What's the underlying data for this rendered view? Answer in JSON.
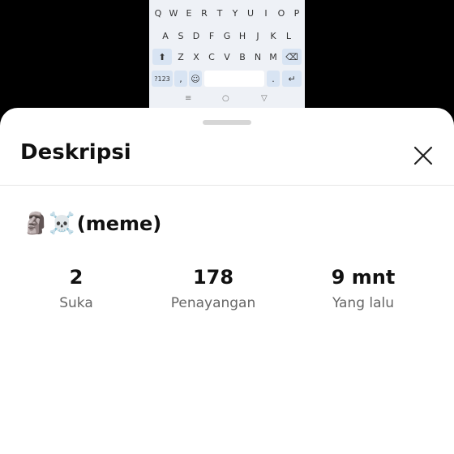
{
  "keyboard": {
    "row1": [
      "Q",
      "W",
      "E",
      "R",
      "T",
      "Y",
      "U",
      "I",
      "O",
      "P"
    ],
    "row2": [
      "A",
      "S",
      "D",
      "F",
      "G",
      "H",
      "J",
      "K",
      "L"
    ],
    "row3": [
      "Z",
      "X",
      "C",
      "V",
      "B",
      "N",
      "M"
    ],
    "shift_key": "⬆",
    "backspace_key": "⌫",
    "sym_key": "?123",
    "comma_key": ",",
    "emoji_key": "☺",
    "period_key": ".",
    "enter_key": "↵",
    "nav_back": "≡",
    "nav_home": "○",
    "nav_recent": "▽"
  },
  "sheet": {
    "title": "Deskripsi",
    "close_icon": "close-icon",
    "description_emoji": "🗿☠️",
    "description_text": "(meme)",
    "stats": [
      {
        "value": "2",
        "label": "Suka"
      },
      {
        "value": "178",
        "label": "Penayangan"
      },
      {
        "value": "9 mnt",
        "label": "Yang lalu"
      }
    ]
  }
}
